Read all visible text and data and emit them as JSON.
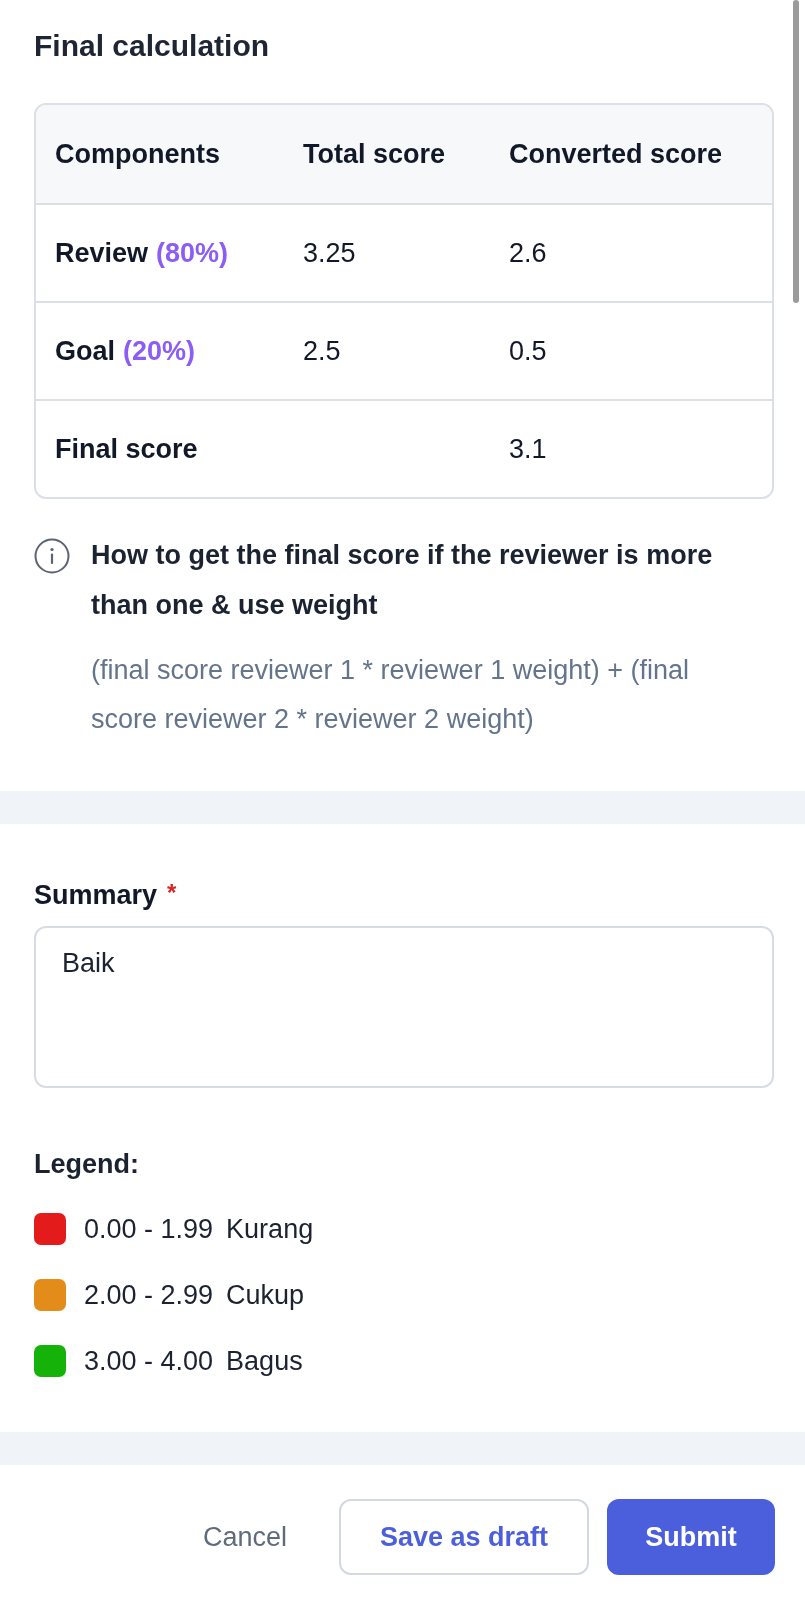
{
  "title": "Final calculation",
  "table": {
    "columns": [
      "Components",
      "Total score",
      "Converted score"
    ],
    "rows": [
      {
        "component": "Review",
        "weight": "(80%)",
        "total_score": "3.25",
        "converted_score": "2.6"
      },
      {
        "component": "Goal",
        "weight": "(20%)",
        "total_score": "2.5",
        "converted_score": "0.5"
      },
      {
        "component": "Final score",
        "converted_score": "3.1"
      }
    ]
  },
  "info": {
    "heading": "How to get the final score if the reviewer is more than one & use weight",
    "formula": "(final score reviewer 1 * reviewer 1 weight) + (final score reviewer 2 * reviewer 2 weight)"
  },
  "summary": {
    "label": "Summary",
    "required_mark": "*",
    "value": "Baik"
  },
  "legend": {
    "title": "Legend:",
    "items": [
      {
        "range": "0.00 - 1.99",
        "label": "Kurang",
        "color": "#e31b1b"
      },
      {
        "range": "2.00 - 2.99",
        "label": "Cukup",
        "color": "#e38c1a"
      },
      {
        "range": "3.00 - 4.00",
        "label": "Bagus",
        "color": "#15b30a"
      }
    ]
  },
  "buttons": [
    {
      "label": "Cancel",
      "kind": "text"
    },
    {
      "label": "Save as draft",
      "kind": "outline"
    },
    {
      "label": "Submit",
      "kind": "primary"
    }
  ]
}
